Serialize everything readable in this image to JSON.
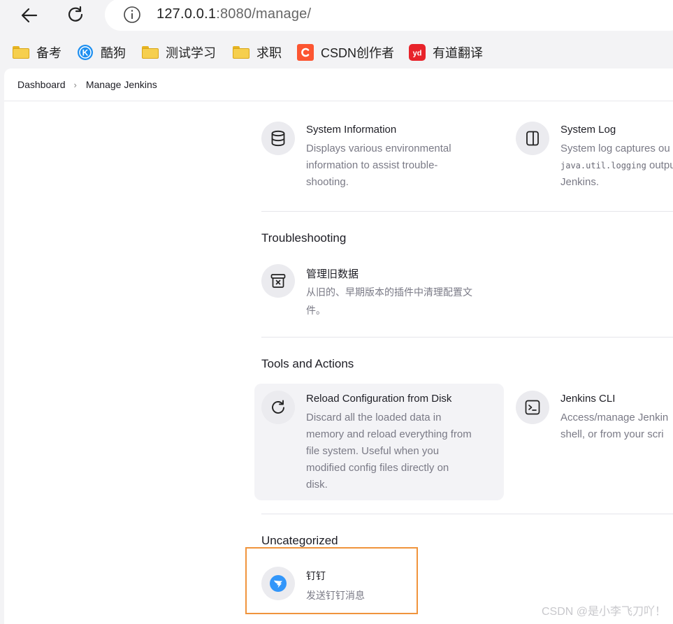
{
  "browser": {
    "url_host": "127.0.0.1",
    "url_rest": ":8080/manage/",
    "bookmarks": [
      {
        "label": "备考",
        "icon": "folder-icon"
      },
      {
        "label": "酷狗",
        "icon": "kugou-icon"
      },
      {
        "label": "测试学习",
        "icon": "folder-icon"
      },
      {
        "label": "求职",
        "icon": "folder-icon"
      },
      {
        "label": "CSDN创作者",
        "icon": "csdn-icon"
      },
      {
        "label": "有道翻译",
        "icon": "youdao-icon"
      }
    ]
  },
  "breadcrumb": {
    "home": "Dashboard",
    "current": "Manage Jenkins"
  },
  "status_info": {
    "system_information": {
      "title": "System Information",
      "desc": "Displays various environmental information to assist trouble-shooting.",
      "desc_lines": [
        "Displays various environmental",
        "information to assist trouble-",
        "shooting."
      ]
    },
    "system_log": {
      "title": "System Log",
      "desc_line1": "System log captures ou",
      "desc_code": "java.util.logging",
      "desc_line2_rest": " outpu",
      "desc_line3": "Jenkins."
    }
  },
  "troubleshooting": {
    "section_title": "Troubleshooting",
    "old_data": {
      "title": "管理旧数据",
      "desc_lines": [
        "从旧的、早期版本的插件中清理配置文",
        "件。"
      ]
    }
  },
  "tools": {
    "section_title": "Tools and Actions",
    "reload": {
      "title": "Reload Configuration from Disk",
      "desc_lines": [
        "Discard all the loaded data in",
        "memory and reload everything from",
        "file system. Useful when you",
        "modified config files directly on",
        "disk."
      ]
    },
    "cli": {
      "title": "Jenkins CLI",
      "desc_lines": [
        "Access/manage Jenkin",
        "shell, or from your scri"
      ]
    }
  },
  "uncategorized": {
    "section_title": "Uncategorized",
    "dingtalk": {
      "title": "钉钉",
      "desc": "发送钉钉消息"
    }
  },
  "watermark": "CSDN @是小李飞刀吖！",
  "colors": {
    "highlight": "#f0943c",
    "icon_bg": "#ebebef",
    "dingtalk_blue": "#3296fa"
  }
}
